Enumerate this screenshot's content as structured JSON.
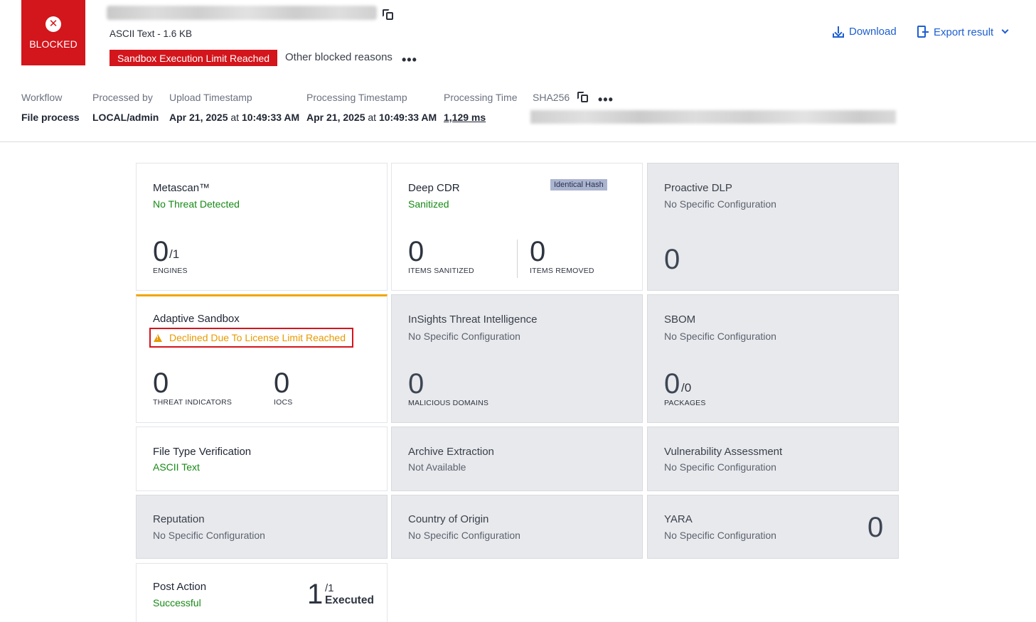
{
  "header": {
    "verdict": "BLOCKED",
    "file_meta": "ASCII Text - 1.6 KB",
    "blocked_reason": "Sandbox Execution Limit Reached",
    "other_reasons": "Other blocked reasons",
    "more": "•••",
    "download_label": "Download",
    "export_label": "Export result"
  },
  "meta": {
    "workflow_label": "Workflow",
    "workflow_value": "File process",
    "processed_by_label": "Processed by",
    "processed_by_value": "LOCAL/admin",
    "upload_label": "Upload Timestamp",
    "upload_date": "Apr 21, 2025",
    "upload_at": "at",
    "upload_time": "10:49:33 AM",
    "processing_ts_label": "Processing Timestamp",
    "processing_date": "Apr 21, 2025",
    "processing_at": "at",
    "processing_time_ts": "10:49:33 AM",
    "processing_time_label": "Processing Time",
    "processing_time_value": "1,129 ms",
    "sha_label": "SHA256"
  },
  "cards": {
    "metascan": {
      "title": "Metascan™",
      "status": "No Threat Detected",
      "num": "0",
      "sub": "/1",
      "label": "ENGINES"
    },
    "deepcdr": {
      "title": "Deep CDR",
      "status": "Sanitized",
      "badge": "Identical Hash",
      "num1": "0",
      "label1": "ITEMS SANITIZED",
      "num2": "0",
      "label2": "ITEMS REMOVED"
    },
    "dlp": {
      "title": "Proactive DLP",
      "status": "No Specific Configuration",
      "num": "0"
    },
    "sandbox": {
      "title": "Adaptive Sandbox",
      "status": "Declined Due To License Limit Reached",
      "num1": "0",
      "label1": "THREAT INDICATORS",
      "num2": "0",
      "label2": "IOCS"
    },
    "insights": {
      "title": "InSights Threat Intelligence",
      "status": "No Specific Configuration",
      "num": "0",
      "label": "MALICIOUS DOMAINS"
    },
    "sbom": {
      "title": "SBOM",
      "status": "No Specific Configuration",
      "num": "0",
      "sub": "/0",
      "label": "PACKAGES"
    },
    "filetype": {
      "title": "File Type Verification",
      "status": "ASCII Text"
    },
    "archive": {
      "title": "Archive Extraction",
      "status": "Not Available"
    },
    "vuln": {
      "title": "Vulnerability Assessment",
      "status": "No Specific Configuration"
    },
    "reputation": {
      "title": "Reputation",
      "status": "No Specific Configuration"
    },
    "country": {
      "title": "Country of Origin",
      "status": "No Specific Configuration"
    },
    "yara": {
      "title": "YARA",
      "status": "No Specific Configuration",
      "num": "0"
    },
    "postaction": {
      "title": "Post Action",
      "status": "Successful",
      "num": "1",
      "sub": "/1",
      "label": "Executed"
    }
  },
  "colors": {
    "blocked_red": "#d3151c",
    "link_blue": "#1d5fd1",
    "success_green": "#168a16",
    "warning_orange": "#e89a00"
  }
}
